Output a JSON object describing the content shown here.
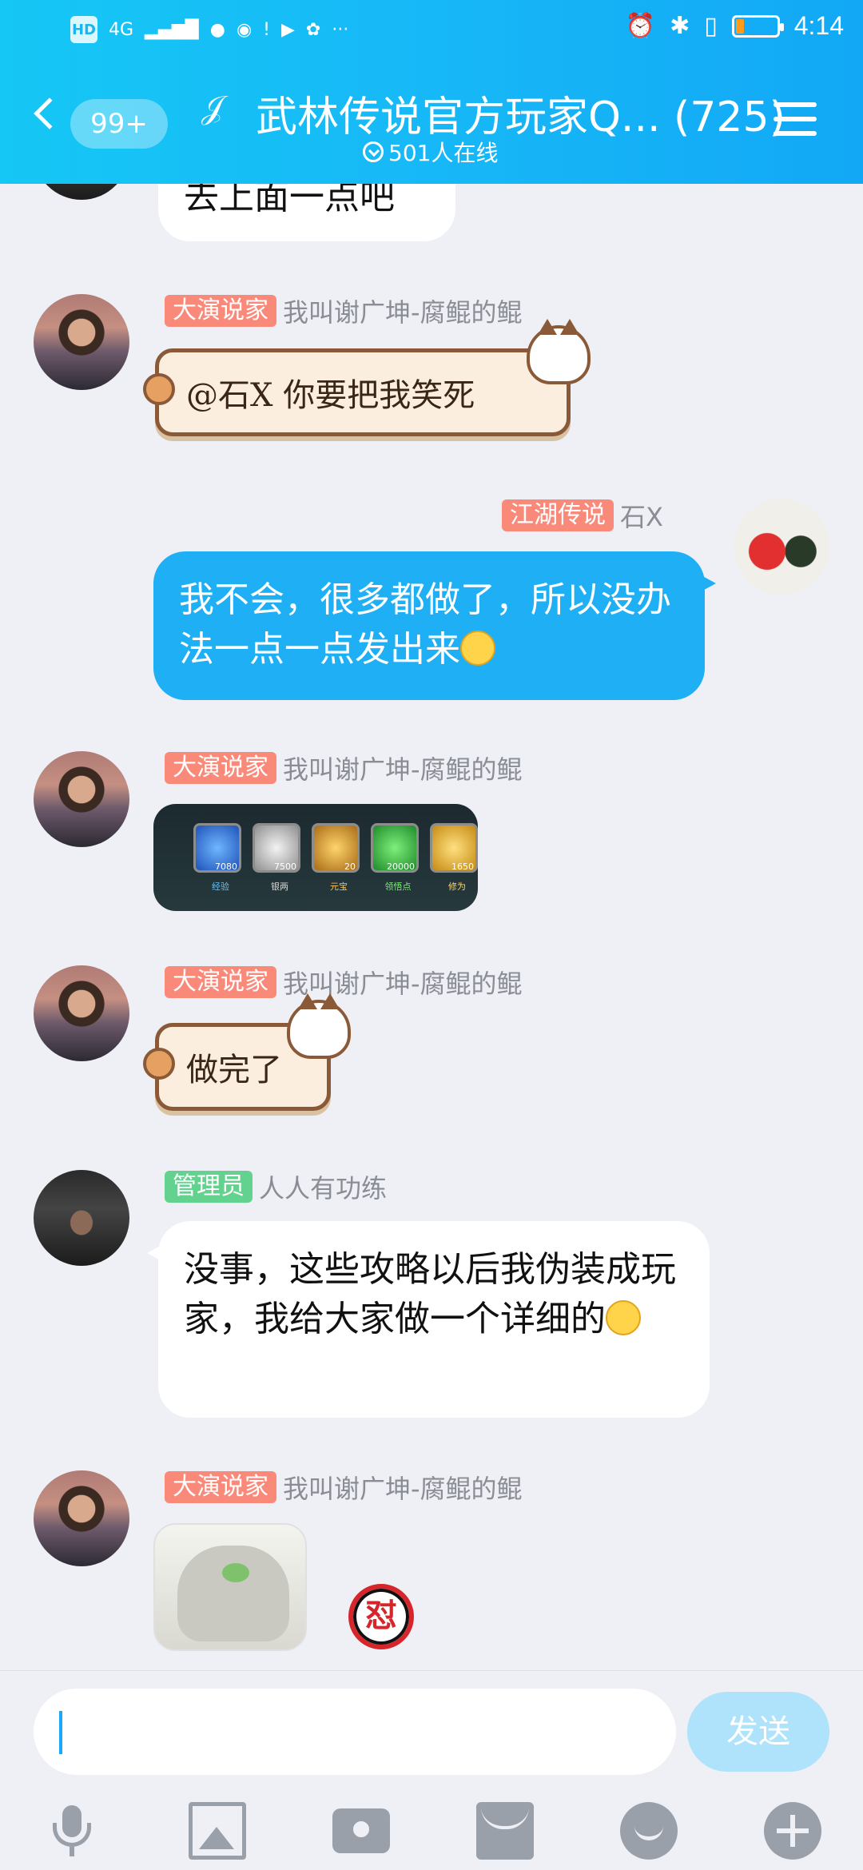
{
  "status_bar": {
    "left_icons": [
      "HD",
      "4G"
    ],
    "time": "4:14",
    "battery_level": 0.2
  },
  "header": {
    "unread": "99+",
    "title": "武林传说官方玩家Q... (725)",
    "online": "501人在线"
  },
  "messages": [
    {
      "type": "partial",
      "text": "去上面一点吧"
    },
    {
      "type": "sticker_text",
      "tag": "大演说家",
      "name": "我叫谢广坤-腐鲲的鲲",
      "text": "@石X 你要把我笑死"
    },
    {
      "type": "text",
      "self": true,
      "tag": "江湖传说",
      "name": "石X",
      "text": "我不会，很多都做了，所以没办法一点一点发出来"
    },
    {
      "type": "image_items",
      "tag": "大演说家",
      "name": "我叫谢广坤-腐鲲的鲲",
      "items": [
        {
          "num": "7080",
          "label": "经验"
        },
        {
          "num": "7500",
          "label": "银两"
        },
        {
          "num": "20",
          "label": "元宝"
        },
        {
          "num": "20000",
          "label": "领悟点"
        },
        {
          "num": "1650",
          "label": "修为"
        }
      ]
    },
    {
      "type": "sticker_text",
      "tag": "大演说家",
      "name": "我叫谢广坤-腐鲲的鲲",
      "text": "做完了"
    },
    {
      "type": "text",
      "tag": "管理员",
      "name": "人人有功练",
      "text": "没事，这些攻略以后我伪装成玩家，我给大家做一个详细的"
    },
    {
      "type": "image_sticker",
      "tag": "大演说家",
      "name": "我叫谢广坤-腐鲲的鲲",
      "badge": "怼"
    }
  ],
  "input": {
    "send_label": "发送"
  }
}
